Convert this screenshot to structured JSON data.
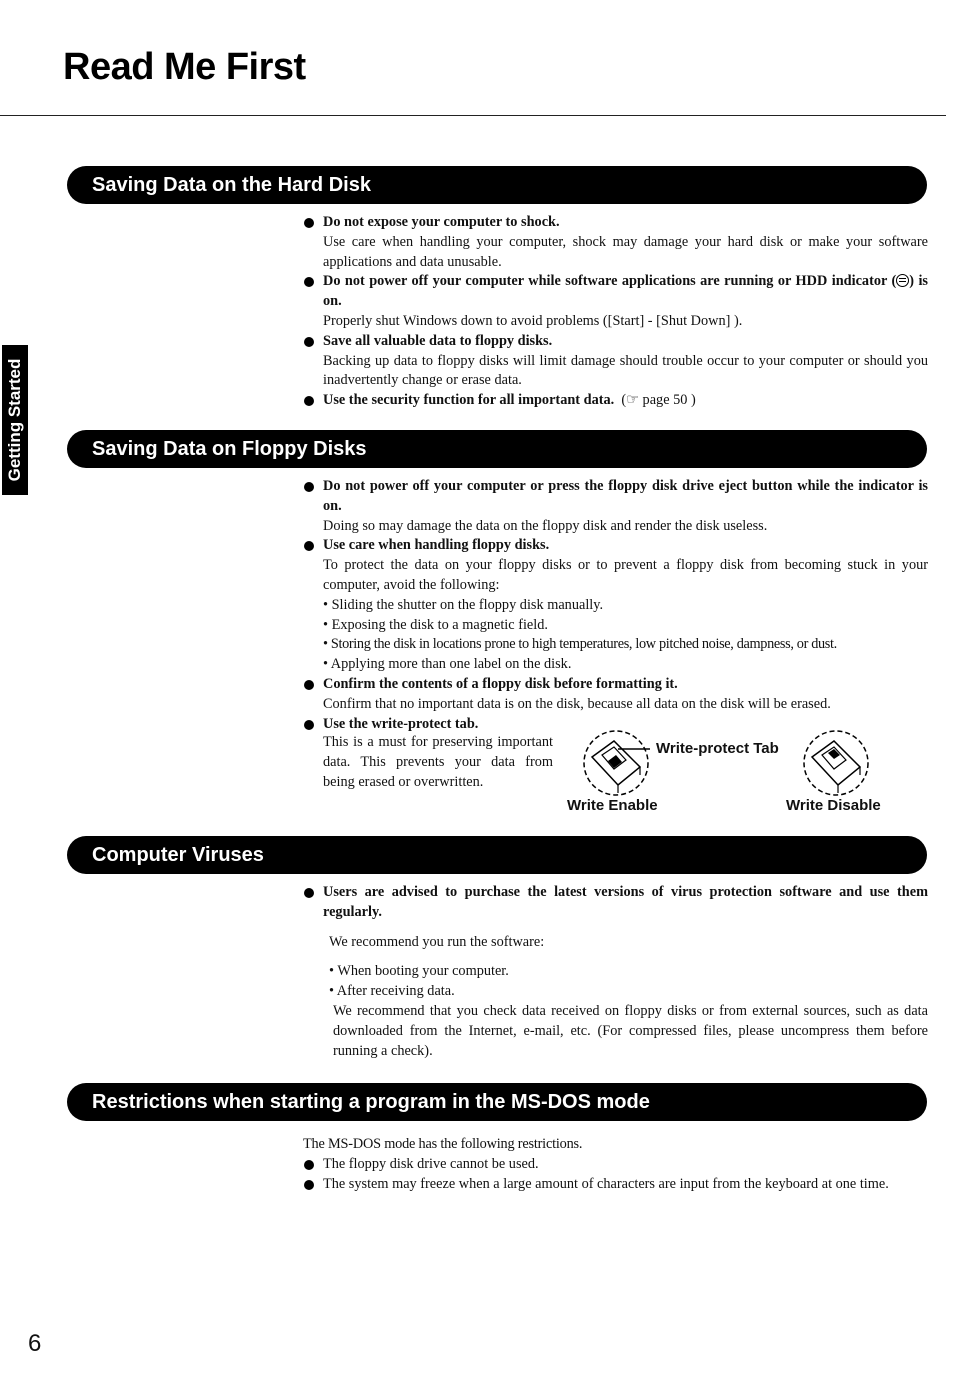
{
  "page": {
    "title": "Read Me First",
    "side_tab": "Getting Started",
    "page_number": "6"
  },
  "sections": [
    {
      "heading": "Saving Data on the Hard Disk",
      "items": [
        {
          "title": "Do not expose your computer to shock.",
          "body": "Use care when handling your computer, shock may damage your hard disk or make your software applications and data unusable."
        },
        {
          "title_pre": "Do not power off your computer while software applications are running or HDD indicator (",
          "icon": "hdd-indicator-icon",
          "title_post": ") is on.",
          "body": "Properly shut Windows down to avoid problems ([Start] - [Shut Down] )."
        },
        {
          "title": "Save all valuable data to floppy disks.",
          "body": "Backing up data to floppy disks will limit damage should trouble occur to your computer or should you inadvertently change or erase data."
        },
        {
          "title": "Use the security function for all important data.",
          "ref_icon": "pointing-hand-icon",
          "ref": "page 50"
        }
      ]
    },
    {
      "heading": "Saving Data on Floppy Disks",
      "items": [
        {
          "title": "Do not power off your computer or press the floppy disk drive eject button while the indicator is on.",
          "body": "Doing so may damage the data on the floppy disk and render the disk useless."
        },
        {
          "title": "Use care when handling floppy disks.",
          "body": "To protect the data on your floppy disks or to prevent a floppy disk from becoming stuck in your computer, avoid the following:",
          "sub": [
            "• Sliding the shutter on the floppy disk manually.",
            "• Exposing the disk to a magnetic field.",
            "• Storing the disk in locations prone to high temperatures, low pitched noise, dampness, or dust.",
            "• Applying more than one label on the disk."
          ]
        },
        {
          "title": "Confirm the contents of a floppy disk before formatting it.",
          "body": "Confirm that no important data is on the disk, because all data on the disk will be erased."
        },
        {
          "title": "Use the write-protect tab.",
          "body": "This is a must for preserving important data. This prevents your data from being erased or overwritten."
        }
      ],
      "figure": {
        "callout": "Write-protect Tab",
        "left_caption": "Write Enable",
        "right_caption": "Write Disable"
      }
    },
    {
      "heading": "Computer Viruses",
      "items": [
        {
          "title": "Users are advised to purchase the latest versions of virus protection software and use them regularly."
        }
      ],
      "intro": "We recommend you run the software:",
      "sub": [
        "• When booting your computer.",
        "• After receiving data."
      ],
      "detail": "We recommend that you check data received on floppy disks or from external sources, such as data downloaded from the Internet, e-mail, etc. (For compressed files, please uncompress them before running a check)."
    },
    {
      "heading": "Restrictions when starting a program in the MS-DOS mode",
      "intro": "The MS-DOS mode has the following restrictions.",
      "items": [
        {
          "body": "The floppy disk drive cannot be used."
        },
        {
          "body": "The system may freeze when a large amount of characters are input from the keyboard at one time."
        }
      ]
    }
  ]
}
